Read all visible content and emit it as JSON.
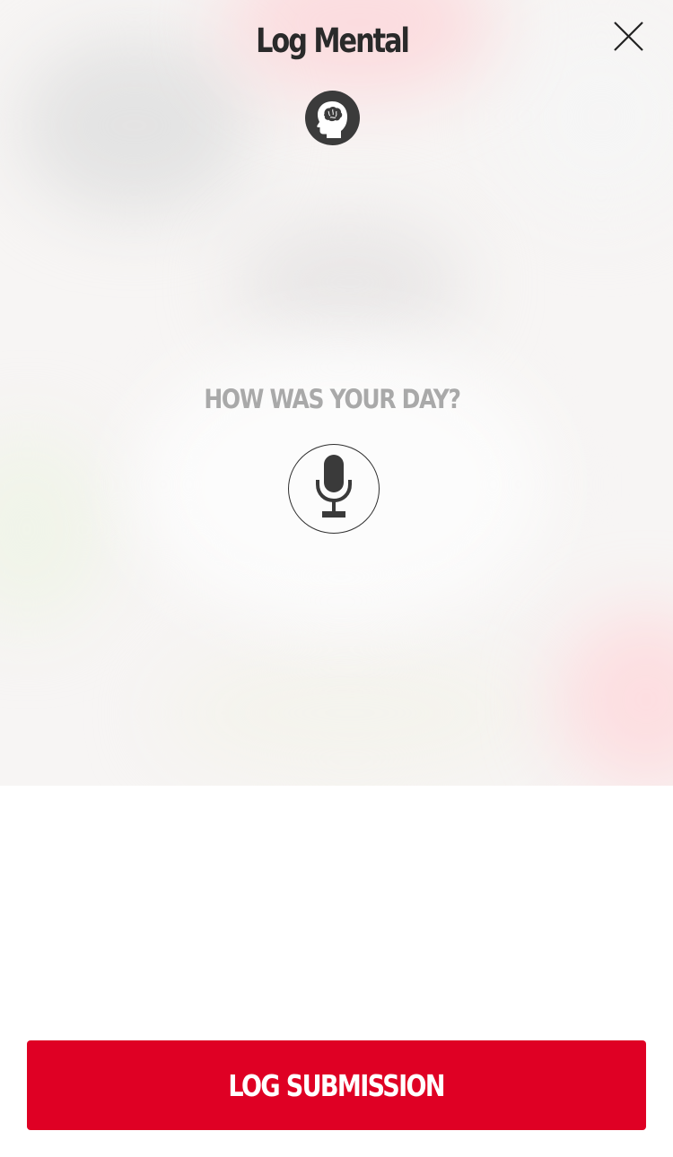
{
  "header": {
    "title": "Log Mental",
    "close_icon": "close-icon",
    "category_icon": "brain-icon"
  },
  "prompt": {
    "text": "HOW WAS YOUR DAY?",
    "mic_icon": "microphone-icon"
  },
  "footer": {
    "submit_label": "LOG SUBMISSION"
  },
  "colors": {
    "accent": "#df0024",
    "title_text": "#2a2a2a",
    "prompt_text": "#a9a9a9",
    "badge": "#3b3b3b"
  }
}
